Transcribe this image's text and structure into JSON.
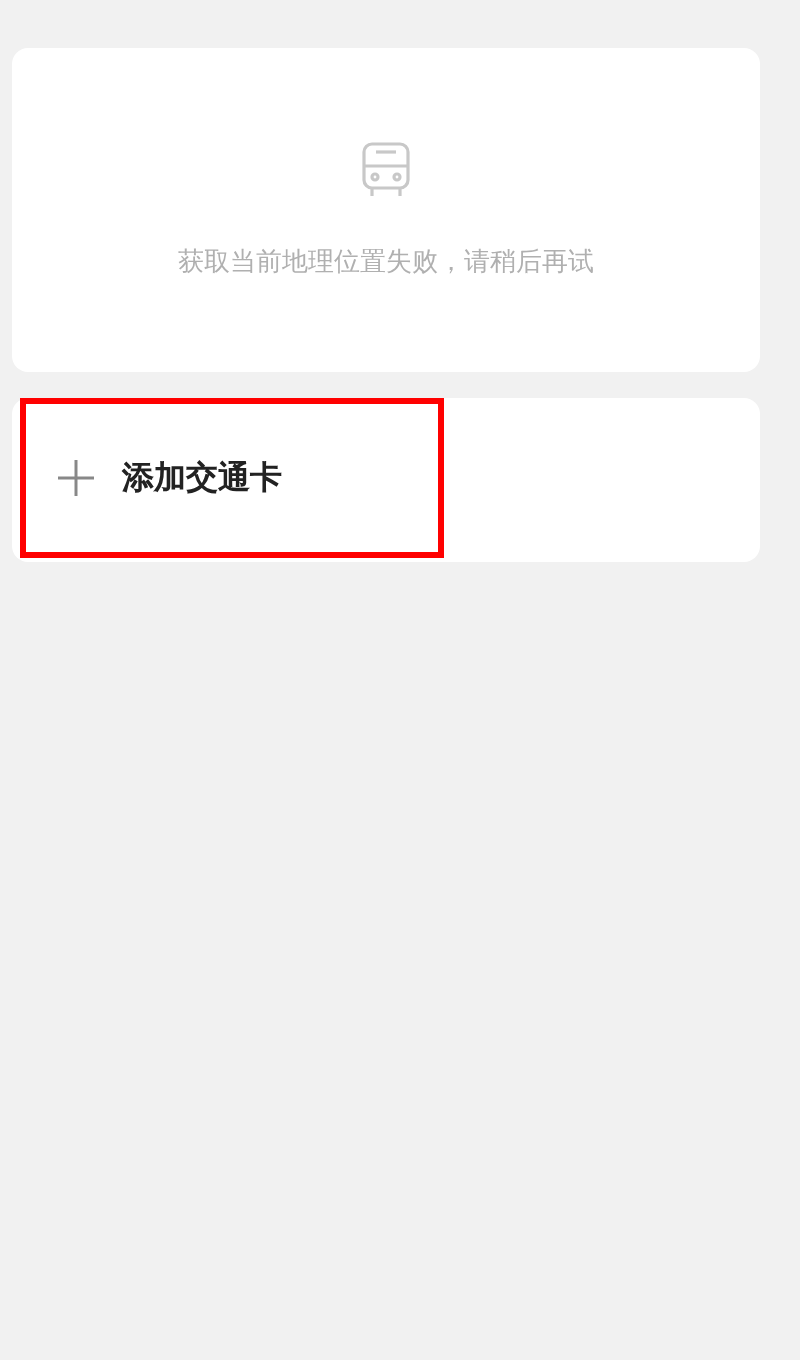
{
  "location_card": {
    "message": "获取当前地理位置失败，请稍后再试"
  },
  "add_card": {
    "label": "添加交通卡",
    "highlighted": true
  }
}
